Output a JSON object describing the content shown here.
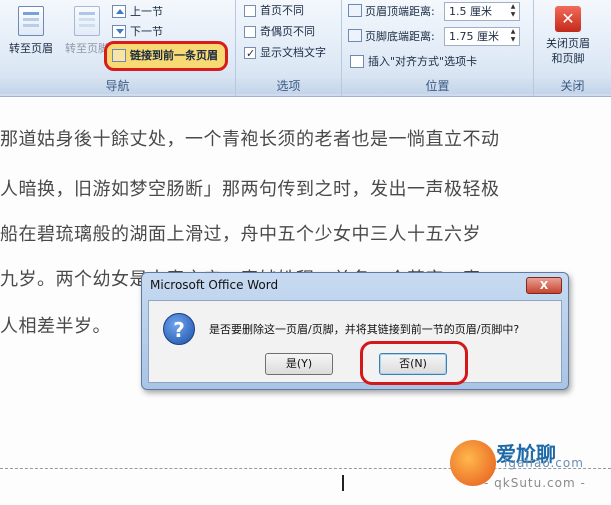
{
  "ribbon": {
    "navigation": {
      "label": "导航",
      "goto_header": "转至页眉",
      "goto_footer": "转至页脚",
      "prev_section": "上一节",
      "next_section": "下一节",
      "link_to_previous": "链接到前一条页眉"
    },
    "options": {
      "label": "选项",
      "first_page_diff": "首页不同",
      "odd_even_diff": "奇偶页不同",
      "show_doc_text": "显示文档文字",
      "show_doc_text_checked": true
    },
    "position": {
      "label": "位置",
      "header_distance_label": "页眉顶端距离:",
      "header_distance_value": "1.5 厘米",
      "footer_distance_label": "页脚底端距离:",
      "footer_distance_value": "1.75 厘米",
      "insert_align_tab": "插入\"对齐方式\"选项卡"
    },
    "close": {
      "label": "关闭",
      "close_button_line1": "关闭页眉",
      "close_button_line2": "和页脚"
    }
  },
  "document": {
    "lines": [
      "那道姑身後十餘丈处，一个青袍长须的老者也是一惝直立不动",
      "人暗换，旧游如梦空肠断」那两句传到之时，发出一声极轻极",
      "船在碧琉璃般的湖面上滑过，舟中五个少女中三人十五六岁",
      "九岁。两个幼女是中表之亲，表姊姓程，单名一个英字，表",
      "人相差半岁。"
    ]
  },
  "dialog": {
    "title": "Microsoft Office Word",
    "close_label": "X",
    "message": "是否要删除这一页眉/页脚，并将其链接到前一节的页眉/页脚中?",
    "yes_label": "是(Y)",
    "no_label": "否(N)"
  },
  "watermark": {
    "brand": "爱尬聊",
    "url": "lgaliao.com",
    "sub": "- qkSutu.com -"
  }
}
